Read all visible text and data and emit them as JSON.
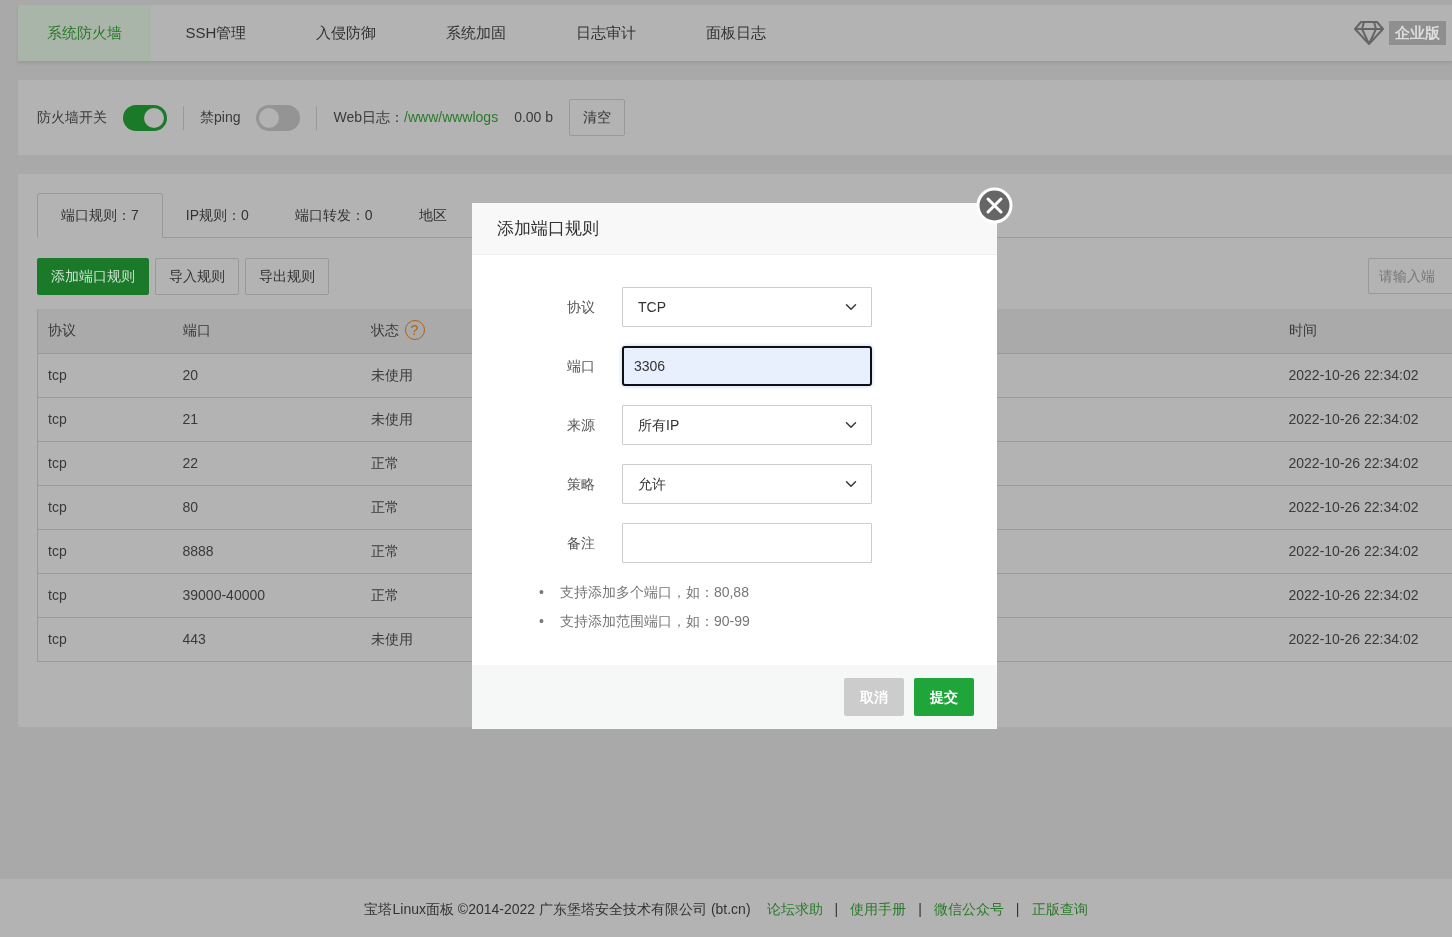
{
  "top_tabs": [
    {
      "label": "系统防火墙",
      "selected": true
    },
    {
      "label": "SSH管理",
      "selected": false
    },
    {
      "label": "入侵防御",
      "selected": false
    },
    {
      "label": "系统加固",
      "selected": false
    },
    {
      "label": "日志审计",
      "selected": false
    },
    {
      "label": "面板日志",
      "selected": false
    }
  ],
  "edition_badge": "企业版",
  "toolbar": {
    "switches": [
      {
        "label": "防火墙开关",
        "on": true
      },
      {
        "label": "禁ping",
        "on": false
      }
    ],
    "web_log_label": "Web日志：",
    "web_log_path": "/www/wwwlogs",
    "web_log_size": "0.00 b",
    "clear_button": "清空"
  },
  "rule_tabs": [
    {
      "label": "端口规则：7",
      "selected": true
    },
    {
      "label": "IP规则：0",
      "selected": false
    },
    {
      "label": "端口转发：0",
      "selected": false
    },
    {
      "label": "地区",
      "selected": false
    }
  ],
  "actions": [
    {
      "label": "添加端口规则",
      "kind": "primary"
    },
    {
      "label": "导入规则",
      "kind": "default"
    },
    {
      "label": "导出规则",
      "kind": "default"
    }
  ],
  "search": {
    "placeholder": "请输入端"
  },
  "table": {
    "columns": [
      {
        "label": "协议"
      },
      {
        "label": "端口"
      },
      {
        "label": "状态",
        "help": "?"
      },
      {
        "label": "时间"
      }
    ],
    "rows": [
      [
        "tcp",
        "20",
        "未使用",
        "2022-10-26 22:34:02"
      ],
      [
        "tcp",
        "21",
        "未使用",
        "2022-10-26 22:34:02"
      ],
      [
        "tcp",
        "22",
        "正常",
        "2022-10-26 22:34:02"
      ],
      [
        "tcp",
        "80",
        "正常",
        "2022-10-26 22:34:02"
      ],
      [
        "tcp",
        "8888",
        "正常",
        "2022-10-26 22:34:02"
      ],
      [
        "tcp",
        "39000-40000",
        "正常",
        "2022-10-26 22:34:02"
      ],
      [
        "tcp",
        "443",
        "未使用",
        "2022-10-26 22:34:02"
      ]
    ]
  },
  "dialog": {
    "title": "添加端口规则",
    "fields": [
      {
        "label": "协议",
        "kind": "select",
        "value": "TCP",
        "focused": false
      },
      {
        "label": "端口",
        "kind": "input",
        "value": "3306",
        "focused": true
      },
      {
        "label": "来源",
        "kind": "select",
        "value": "所有IP",
        "focused": false
      },
      {
        "label": "策略",
        "kind": "select",
        "value": "允许",
        "focused": false
      },
      {
        "label": "备注",
        "kind": "input",
        "focused": false
      }
    ],
    "bullet": "•",
    "notes": [
      "支持添加多个端口，如：80,88",
      "支持添加范围端口，如：90-99"
    ],
    "buttons": [
      {
        "label": "取消",
        "kind": "cancel"
      },
      {
        "label": "提交",
        "kind": "submit"
      }
    ]
  },
  "footer": {
    "text": "宝塔Linux面板 ©2014-2022 广东堡塔安全技术有限公司 (bt.cn)",
    "separator": "|",
    "links": [
      "论坛求助",
      "使用手册",
      "微信公众号",
      "正版查询"
    ]
  }
}
